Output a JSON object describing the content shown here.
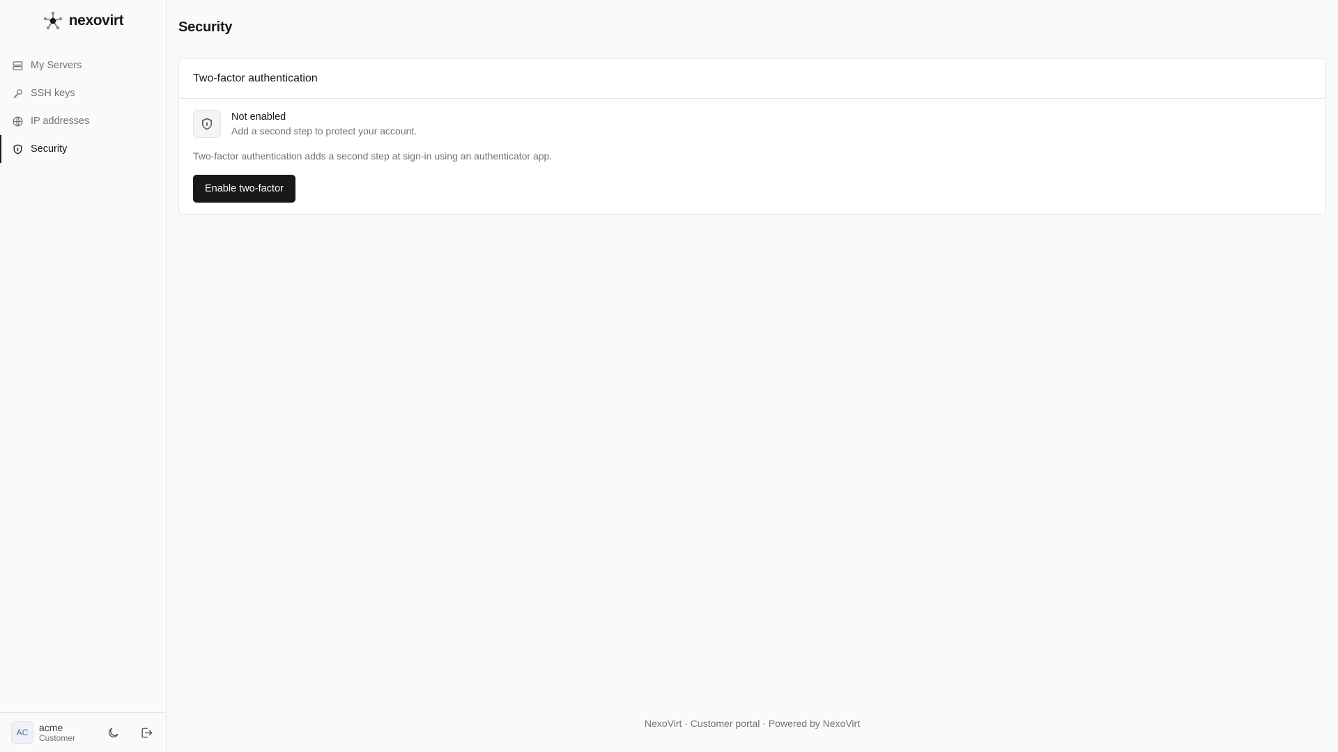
{
  "brand": {
    "name": "nexovirt",
    "logo_icon": "network-nodes-icon"
  },
  "sidebar": {
    "items": [
      {
        "label": "My Servers",
        "icon": "server-icon",
        "active": false
      },
      {
        "label": "SSH keys",
        "icon": "key-icon",
        "active": false
      },
      {
        "label": "IP addresses",
        "icon": "globe-icon",
        "active": false
      },
      {
        "label": "Security",
        "icon": "shield-icon",
        "active": true
      }
    ]
  },
  "user": {
    "initials": "AC",
    "name": "acme",
    "role": "Customer",
    "theme_toggle_icon": "moon-icon",
    "logout_icon": "logout-icon"
  },
  "page": {
    "title": "Security"
  },
  "two_factor": {
    "card_title": "Two-factor authentication",
    "status_icon": "shield-icon",
    "status_title": "Not enabled",
    "status_subtitle": "Add a second step to protect your account.",
    "description": "Two-factor authentication adds a second step at sign-in using an authenticator app.",
    "enable_button": "Enable two-factor"
  },
  "footer": {
    "text": "NexoVirt · Customer portal · Powered by NexoVirt"
  },
  "colors": {
    "background": "#fafafa",
    "primary": "#18181b",
    "muted_text": "#71717a",
    "border": "#e4e4e7",
    "card": "#ffffff"
  }
}
